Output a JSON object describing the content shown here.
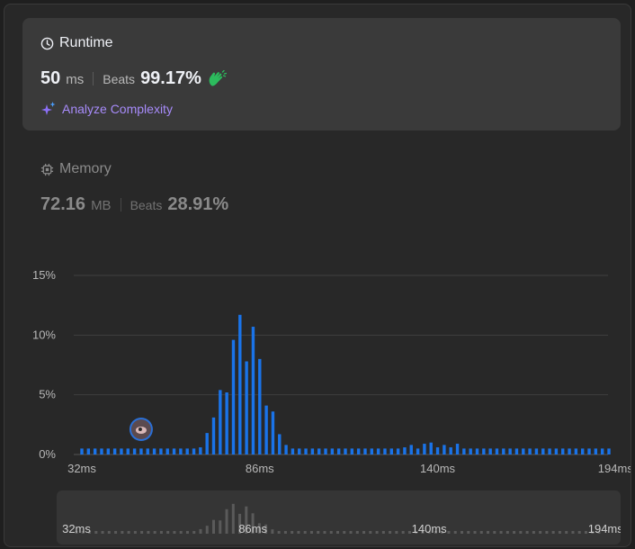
{
  "runtime": {
    "title": "Runtime",
    "value": "50",
    "unit": "ms",
    "beats_label": "Beats",
    "beats_value": "99.17%",
    "icon": "clock-icon",
    "hands_icon": "clapping-hands-icon"
  },
  "analyze": {
    "label": "Analyze Complexity",
    "icon": "sparkle-icon"
  },
  "memory": {
    "title": "Memory",
    "value": "72.16",
    "unit": "MB",
    "beats_label": "Beats",
    "beats_value": "28.91%",
    "icon": "chip-icon"
  },
  "colors": {
    "bar": "#1a73e8",
    "mini_bar": "#5a5a5a",
    "accent_green": "#2cbb5d",
    "purple": "#a78bfa"
  },
  "chart_data": {
    "type": "bar",
    "title": "",
    "ylabel": "",
    "xlabel": "",
    "x_unit": "ms",
    "x_start": 32,
    "x_step": 2,
    "ylim": [
      0,
      15
    ],
    "y_ticks": [
      "15%",
      "10%",
      "5%",
      "0%"
    ],
    "x_ticks": [
      "32ms",
      "86ms",
      "140ms",
      "194ms"
    ],
    "x_tick_values": [
      32,
      86,
      140,
      194
    ],
    "grid": true,
    "user_marker": {
      "x": 50,
      "label": "avatar"
    },
    "values": [
      0.5,
      0.5,
      0.5,
      0.5,
      0.5,
      0.5,
      0.5,
      0.5,
      0.5,
      0.5,
      0.5,
      0.5,
      0.5,
      0.5,
      0.5,
      0.5,
      0.5,
      0.5,
      0.6,
      1.8,
      3.1,
      5.4,
      5.2,
      9.6,
      11.7,
      7.8,
      10.7,
      8.0,
      4.1,
      3.6,
      1.7,
      0.8,
      0.5,
      0.5,
      0.5,
      0.5,
      0.5,
      0.5,
      0.5,
      0.5,
      0.5,
      0.5,
      0.5,
      0.5,
      0.5,
      0.5,
      0.5,
      0.5,
      0.5,
      0.6,
      0.8,
      0.5,
      0.9,
      1.0,
      0.6,
      0.8,
      0.6,
      0.9,
      0.5,
      0.5,
      0.5,
      0.5,
      0.5,
      0.5,
      0.5,
      0.5,
      0.5,
      0.5,
      0.5,
      0.5,
      0.5,
      0.5,
      0.5,
      0.5,
      0.5,
      0.5,
      0.5,
      0.5,
      0.5,
      0.5,
      0.5
    ]
  },
  "scroller": {
    "x_ticks": [
      "32ms",
      "86ms",
      "140ms",
      "194ms"
    ]
  }
}
